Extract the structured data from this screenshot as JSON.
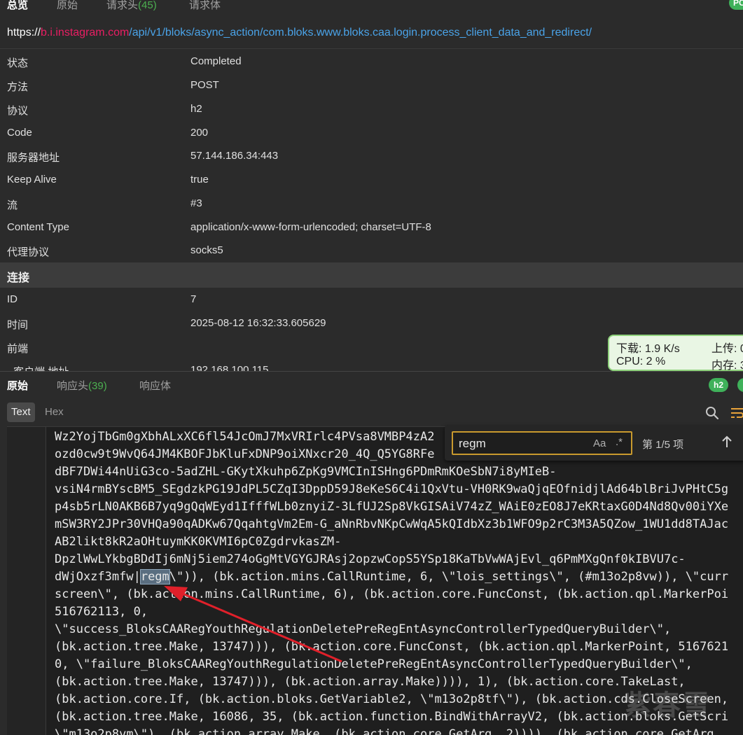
{
  "top_tabs": {
    "overview": "总览",
    "raw": "原始",
    "request_headers": "请求头",
    "request_headers_count": "(45)",
    "request_body": "请求体",
    "badge": "PC"
  },
  "url": {
    "scheme": "https://",
    "host": "b.i.instagram.com",
    "path": "/api/v1/bloks/async_action/com.bloks.www.bloks.caa.login.process_client_data_and_redirect/"
  },
  "overview": [
    {
      "key": "状态",
      "value": "Completed"
    },
    {
      "key": "方法",
      "value": "POST"
    },
    {
      "key": "协议",
      "value": "h2"
    },
    {
      "key": "Code",
      "value": "200"
    },
    {
      "key": "服务器地址",
      "value": "57.144.186.34:443"
    },
    {
      "key": "Keep Alive",
      "value": "true"
    },
    {
      "key": "流",
      "value": "#3"
    },
    {
      "key": "Content Type",
      "value": "application/x-www-form-urlencoded; charset=UTF-8"
    },
    {
      "key": "代理协议",
      "value": "socks5"
    }
  ],
  "connection": {
    "title": "连接",
    "rows": [
      {
        "key": "ID",
        "value": "7"
      },
      {
        "key": "时间",
        "value": "2025-08-12 16:32:33.605629"
      },
      {
        "key": "前端",
        "value": ""
      },
      {
        "key": "- 客户端 地址",
        "value": "192.168.100.115"
      }
    ]
  },
  "netmon": {
    "down": "下载: 1.9 K/s",
    "up": "上传: 0",
    "cpu": "CPU: 2 %",
    "mem": "内存: 3"
  },
  "response_tabs": {
    "raw": "原始",
    "headers": "响应头",
    "headers_count": "(39)",
    "body": "响应体",
    "badge": "h2"
  },
  "view_mode": {
    "text": "Text",
    "hex": "Hex"
  },
  "find": {
    "query": "regm",
    "case": "Aa",
    "regex": ".*",
    "count": "第 1/5 项"
  },
  "code_lines": [
    "Wz2YojTbGm0gXbhALxXC6fl54JcOmJ7MxVRIrlc4PVsa8VMBP4zA2",
    "ozd0cw9t9WvQ64JM4KBOFJbKluFxDNP9oiXNxcr20_4Q_Q5YG8RFe",
    "dBF7DWi44nUiG3co-5adZHL-GKytXkuhp6ZpKg9VMCInISHng6PDmRmKOeSbN7i8yMIeB-",
    "vsiN4rmBYscBM5_SEgdzkPG19JdPL5CZqI3DppD59J8eKeS6C4i1QxVtu-VH0RK9waQjqEOfnidjlAd64blBriJvPHtC5g",
    "p4sb5rLN0AKB6B7yq9gQqWEyd1IfffWLb0znyiZ-3LfUJ2Sp8VkGISAiV74zZ_WAiE0zEO8J7eKRtaxG0D4Nd8Qv00iYXe",
    "mSW3RY2JPr30VHQa90qADKw67QqahtgVm2Em-G_aNnRbvNKpCwWqA5kQIdbXz3b1WFO9p2rC3M3A5QZow_1WU1dd8TAJac",
    "AB2likt8kR2aOHtuymKK0KVMI6pC0ZgdrvkasZM-",
    "DpzlWwLYkbgBDdIj6mNj5iem274oGgMtVGYGJRAsj2opzwCopS5YSp18KaTbVwWAjEvl_q6PmMXgQnf0kIBVU7c-",
    "dWjOxzf3mfw|",
    "regm",
    "\\\")), (bk.action.mins.CallRuntime, 6, \\\"lois_settings\\\", (#m13o2p8vw)), \\\"curr",
    "screen\\\", (bk.action.mins.CallRuntime, 6), (bk.action.core.FuncConst, (bk.action.qpl.MarkerPoi",
    "516762113, 0,",
    "\\\"success_BloksCAARegYouthRegulationDeletePreRegEntAsyncControllerTypedQueryBuilder\\\",",
    "(bk.action.tree.Make, 13747))), (bk.action.core.FuncConst, (bk.action.qpl.MarkerPoint, 5167621",
    "0, \\\"failure_BloksCAARegYouthRegulationDeletePreRegEntAsyncControllerTypedQueryBuilder\\\",",
    "(bk.action.tree.Make, 13747))), (bk.action.array.Make)))), 1), (bk.action.core.TakeLast,",
    "(bk.action.core.If, (bk.action.bloks.GetVariable2, \\\"m13o2p8tf\\\"), (bk.action.cds.CloseScreen,",
    "(bk.action.tree.Make, 16086, 35, (bk.action.function.BindWithArrayV2, (bk.action.bloks.GetScri",
    "\\\"m13o2p8vm\\\"), (bk.action.array.Make, (bk.action.core.GetArg, 2)))), (bk.action.core.GetArg,"
  ],
  "watermark": "紫春雪",
  "colors": {
    "host": "#e91e63",
    "path": "#4aa3e8",
    "count_green": "#4caf50",
    "badge_green": "#3fb15a",
    "find_border": "#c99a2e",
    "arrow_red": "#e0202a"
  },
  "icons": [
    "search-icon",
    "wrap-icon",
    "up-arrow-icon",
    "annotation-arrow"
  ]
}
